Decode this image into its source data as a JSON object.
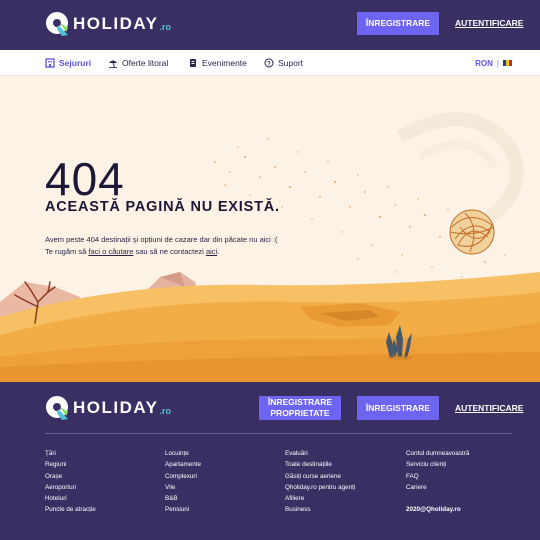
{
  "brand": {
    "name": "HOLIDAY",
    "tld": ".ro"
  },
  "header": {
    "register_label": "ÎNREGISTRARE",
    "login_label": "AUTENTIFICARE"
  },
  "nav": {
    "items": [
      {
        "label": "Sejururi",
        "icon": "building-icon",
        "active": true
      },
      {
        "label": "Oferte litoral",
        "icon": "beach-umbrella-icon",
        "active": false
      },
      {
        "label": "Evenimente",
        "icon": "ticket-icon",
        "active": false
      },
      {
        "label": "Suport",
        "icon": "help-icon",
        "active": false
      }
    ],
    "currency": "RON",
    "separator": "|",
    "flag_icon": "romania-flag-icon"
  },
  "error": {
    "code": "404",
    "title": "ACEASTĂ PAGINĂ NU EXISTĂ.",
    "line1": "Avem peste 404 destinații și opțiuni de cazare dar din păcate nu aici :(",
    "line2_prefix": "Te rugăm să ",
    "search_link": "faci o căutare",
    "line2_middle": " sau să ne contactezi ",
    "contact_link": "aici",
    "line2_suffix": "."
  },
  "footer": {
    "register_property_label": "ÎNREGISTRARE PROPRIETATE",
    "register_label": "ÎNREGISTRARE",
    "login_label": "AUTENTIFICARE",
    "columns": [
      [
        "Țări",
        "Regiuni",
        "Orașe",
        "Aeroporturi",
        "Hoteluri",
        "Puncte de atracție"
      ],
      [
        "Locuințe",
        "Apartamente",
        "Complexuri",
        "Vile",
        "B&B",
        "Pensiuni"
      ],
      [
        "Evaluări",
        "Toate destinațiile",
        "Găsiți curse aeriene",
        "Qholiday.ro pentru agenți",
        "Afiliere",
        "Business"
      ],
      [
        "Contul dumneavoastră",
        "Serviciu clienți",
        "FAQ",
        "Cariere"
      ]
    ],
    "copyright": "2020@Qholiday.ro"
  },
  "colors": {
    "header_bg": "#3a2f63",
    "accent": "#6d64f2",
    "logo_teal": "#4cc3d8",
    "sand": "#f3ad47"
  }
}
